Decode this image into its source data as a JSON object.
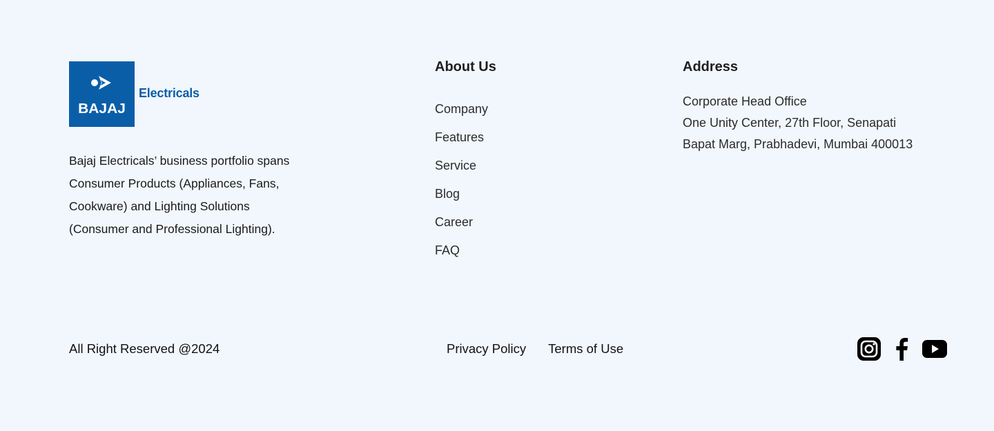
{
  "brand": {
    "logo_word": "BAJAJ",
    "logo_sub": "Electricals",
    "logo_color": "#0a5ea8",
    "description_lines": [
      "Bajaj Electricals’ business portfolio spans",
      "Consumer Products (Appliances, Fans,",
      "Cookware) and Lighting Solutions",
      "(Consumer and Professional Lighting)."
    ]
  },
  "about": {
    "heading": "About Us",
    "links": [
      "Company",
      "Features",
      "Service",
      "Blog",
      "Career",
      "FAQ"
    ]
  },
  "address": {
    "heading": "Address",
    "lines": [
      "Corporate Head Office",
      "One Unity Center, 27th Floor, Senapati",
      "Bapat Marg, Prabhadevi, Mumbai 400013"
    ]
  },
  "bottom": {
    "copyright": "All Right Reserved @2024",
    "privacy": "Privacy Policy",
    "terms": "Terms of Use",
    "social": [
      "instagram-icon",
      "facebook-icon",
      "youtube-icon"
    ]
  },
  "colors": {
    "background": "#f2f7fe",
    "text": "#1a1a1a",
    "brand_blue": "#0a5ea8"
  }
}
